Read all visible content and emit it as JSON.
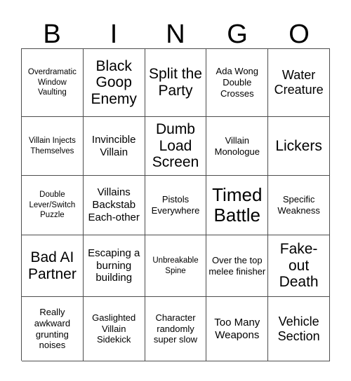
{
  "card": {
    "header_letters": [
      "B",
      "I",
      "N",
      "G",
      "O"
    ],
    "columns": 5,
    "rows": 5,
    "grid_line_color": "#4d4d4d",
    "background_color": "#ffffff",
    "text_color": "#000000",
    "cells": [
      {
        "text": "Overdramatic Window Vaulting",
        "size": "xs"
      },
      {
        "text": "Black Goop Enemy",
        "size": "xl"
      },
      {
        "text": "Split the Party",
        "size": "xl"
      },
      {
        "text": "Ada Wong Double Crosses",
        "size": "sm"
      },
      {
        "text": "Water Creature",
        "size": "lg"
      },
      {
        "text": "Villain Injects Themselves",
        "size": "xs"
      },
      {
        "text": "Invincible Villain",
        "size": "md"
      },
      {
        "text": "Dumb Load Screen",
        "size": "xl"
      },
      {
        "text": "Villain Monologue",
        "size": "sm"
      },
      {
        "text": "Lickers",
        "size": "xl"
      },
      {
        "text": "Double Lever/Switch Puzzle",
        "size": "xs"
      },
      {
        "text": "Villains Backstab Each-other",
        "size": "md"
      },
      {
        "text": "Pistols Everywhere",
        "size": "sm"
      },
      {
        "text": "Timed Battle",
        "size": "xxl"
      },
      {
        "text": "Specific Weakness",
        "size": "sm"
      },
      {
        "text": "Bad AI Partner",
        "size": "xl"
      },
      {
        "text": "Escaping a burning building",
        "size": "md"
      },
      {
        "text": "Unbreakable Spine",
        "size": "xs"
      },
      {
        "text": "Over the top melee finisher",
        "size": "sm"
      },
      {
        "text": "Fake-out Death",
        "size": "xl"
      },
      {
        "text": "Really awkward grunting noises",
        "size": "sm"
      },
      {
        "text": "Gaslighted Villain Sidekick",
        "size": "sm"
      },
      {
        "text": "Character randomly super slow",
        "size": "sm"
      },
      {
        "text": "Too Many Weapons",
        "size": "md"
      },
      {
        "text": "Vehicle Section",
        "size": "lg"
      }
    ]
  }
}
